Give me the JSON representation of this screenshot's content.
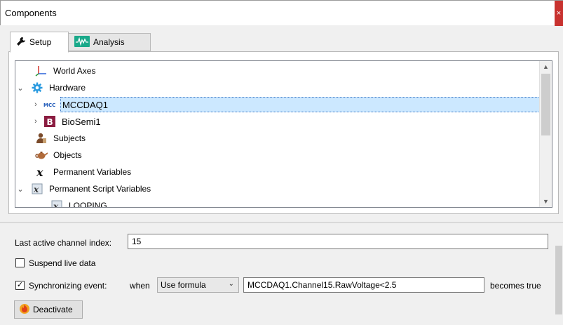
{
  "window": {
    "title": "Components",
    "close_glyph": "×"
  },
  "tabs": [
    {
      "label": "Setup",
      "icon": "wrench-icon",
      "active": true
    },
    {
      "label": "Analysis",
      "icon": "waveform-icon",
      "active": false
    }
  ],
  "tree": {
    "items": [
      {
        "label": "World Axes",
        "icon": "axes-icon",
        "expander": "",
        "indent": 1
      },
      {
        "label": "Hardware",
        "icon": "gear-icon",
        "expander": "⌄",
        "indent": 0
      },
      {
        "label": "MCCDAQ1",
        "icon": "mcc-icon",
        "expander": "›",
        "indent": 1,
        "selected": true
      },
      {
        "label": "BioSemi1",
        "icon": "biosemi-icon",
        "expander": "›",
        "indent": 1
      },
      {
        "label": "Subjects",
        "icon": "subject-icon",
        "expander": "",
        "indent": 0
      },
      {
        "label": "Objects",
        "icon": "teapot-icon",
        "expander": "",
        "indent": 0
      },
      {
        "label": "Permanent Variables",
        "icon": "variable-x-icon",
        "expander": "",
        "indent": 0
      },
      {
        "label": "Permanent Script Variables",
        "icon": "script-variable-icon",
        "expander": "⌄",
        "indent": 0
      },
      {
        "label": "LOOPING",
        "icon": "script-variable-icon",
        "expander": "",
        "indent": 1
      }
    ]
  },
  "properties": {
    "last_active_label": "Last active channel index:",
    "last_active_value": "15",
    "suspend_label": "Suspend live data",
    "suspend_checked": false,
    "sync_label": "Synchronizing event:",
    "sync_checked": true,
    "when_label": "when",
    "when_option": "Use formula",
    "formula_value": "MCCDAQ1.Channel15.RawVoltage<2.5",
    "becomes_label": "becomes true",
    "deactivate_label": "Deactivate"
  },
  "colors": {
    "selection": "#cce8ff",
    "close_button": "#c8322f",
    "biosemi": "#8b1d41",
    "gear": "#2b9be0"
  }
}
